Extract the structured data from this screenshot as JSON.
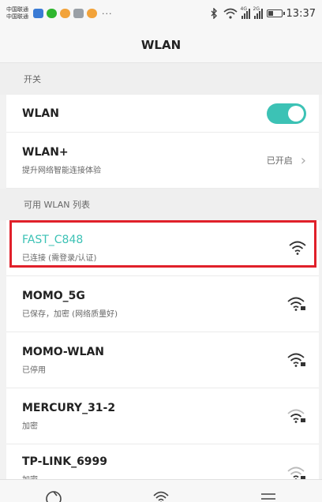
{
  "status_bar": {
    "carrier_1": "中国联通",
    "carrier_2": "中国联通",
    "more": "···",
    "network_1": "4G",
    "network_2": "2G",
    "time": "13:37",
    "battery_level": 0.45,
    "notification_icons": [
      "message-icon",
      "wechat-icon",
      "weibo-icon",
      "gallery-icon",
      "weibo-icon"
    ]
  },
  "title": "WLAN",
  "switch_section": {
    "header": "开关"
  },
  "wlan_toggle": {
    "label": "WLAN",
    "on": true
  },
  "wlan_plus": {
    "label": "WLAN+",
    "sublabel": "提升网络智能连接体验",
    "status": "已开启"
  },
  "list_section": {
    "header": "可用 WLAN 列表"
  },
  "networks": [
    {
      "name": "FAST_C848",
      "status": "已连接 (需登录/认证)",
      "connected": true
    },
    {
      "name": "MOMO_5G",
      "status": "已保存，加密 (网络质量好)",
      "connected": false
    },
    {
      "name": "MOMO-WLAN",
      "status": "已停用",
      "connected": false
    },
    {
      "name": "MERCURY_31-2",
      "status": "加密",
      "connected": false
    },
    {
      "name": "TP-LINK_6999",
      "status": "加密",
      "connected": false
    }
  ],
  "colors": {
    "accent": "#3cc2b5",
    "highlight": "#e0202a"
  }
}
